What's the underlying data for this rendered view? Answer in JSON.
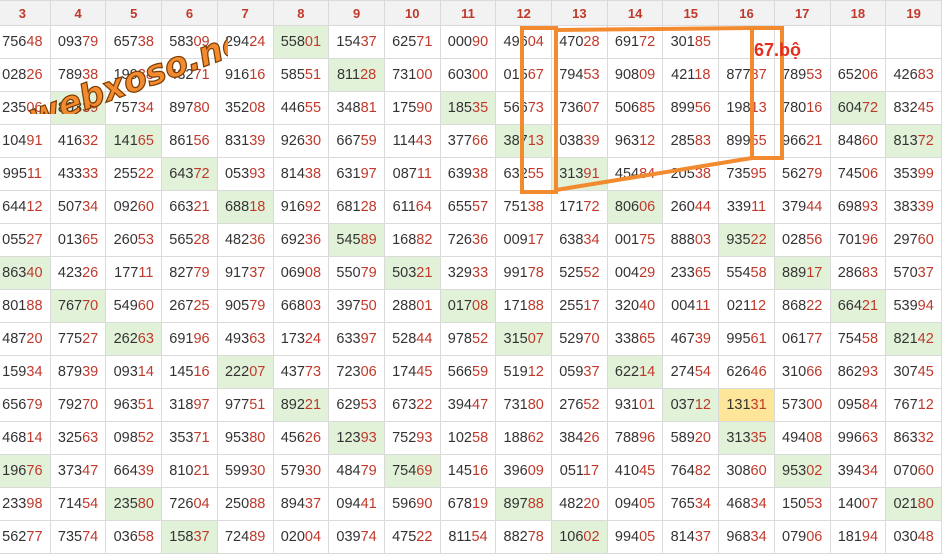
{
  "columns": [
    "3",
    "4",
    "5",
    "6",
    "7",
    "8",
    "9",
    "10",
    "11",
    "12",
    "13",
    "14",
    "15",
    "16",
    "17",
    "18",
    "19"
  ],
  "rows": [
    [
      "75648",
      "09379",
      "65738",
      "58309",
      "29424",
      "55801",
      "15437",
      "62571",
      "00090",
      "49604",
      "47028",
      "69172",
      "30185",
      "",
      "",
      "",
      ""
    ],
    [
      "02826",
      "78938",
      "19938",
      "43271",
      "91616",
      "58551",
      "81128",
      "73100",
      "60300",
      "01567",
      "79453",
      "90809",
      "42118",
      "87787",
      "78953",
      "65206",
      "42683"
    ],
    [
      "23506",
      "80339",
      "75734",
      "89780",
      "35208",
      "44655",
      "34881",
      "17590",
      "18535",
      "56673",
      "73607",
      "50685",
      "89956",
      "19813",
      "78016",
      "60472",
      "83245"
    ],
    [
      "10491",
      "41632",
      "14165",
      "86156",
      "83139",
      "92630",
      "66759",
      "11443",
      "37766",
      "38713",
      "03839",
      "96312",
      "28583",
      "89955",
      "96621",
      "84860",
      "81372"
    ],
    [
      "99511",
      "43333",
      "25522",
      "64372",
      "05393",
      "81438",
      "63197",
      "08711",
      "63938",
      "63255",
      "31391",
      "45484",
      "20538",
      "73595",
      "56279",
      "74506",
      "35399"
    ],
    [
      "64412",
      "50734",
      "09260",
      "66321",
      "68818",
      "91692",
      "68128",
      "61164",
      "65557",
      "75138",
      "17172",
      "80606",
      "26044",
      "33911",
      "37944",
      "69893",
      "38339"
    ],
    [
      "05527",
      "01365",
      "26053",
      "56528",
      "48236",
      "69236",
      "54589",
      "16882",
      "72636",
      "00917",
      "63834",
      "00175",
      "88803",
      "93522",
      "02856",
      "70196",
      "29760"
    ],
    [
      "86340",
      "42326",
      "17711",
      "82779",
      "91737",
      "06908",
      "55079",
      "50321",
      "32933",
      "99178",
      "52552",
      "00429",
      "23365",
      "55458",
      "88917",
      "28683",
      "57037"
    ],
    [
      "80188",
      "76770",
      "54960",
      "26725",
      "90579",
      "66803",
      "39750",
      "28801",
      "01708",
      "17188",
      "25517",
      "32040",
      "00411",
      "02112",
      "86822",
      "66421",
      "53994"
    ],
    [
      "48720",
      "77527",
      "26263",
      "69196",
      "49363",
      "17324",
      "63397",
      "52844",
      "97852",
      "31507",
      "52970",
      "33865",
      "46739",
      "99561",
      "06177",
      "75458",
      "82142"
    ],
    [
      "15934",
      "87939",
      "09314",
      "14516",
      "22207",
      "43773",
      "72306",
      "17445",
      "56659",
      "51912",
      "05937",
      "62214",
      "27454",
      "62646",
      "31066",
      "86293",
      "30745"
    ],
    [
      "65679",
      "79270",
      "96351",
      "31897",
      "97751",
      "89221",
      "62953",
      "67322",
      "39447",
      "73180",
      "27652",
      "93101",
      "03712",
      "13131",
      "57300",
      "09584",
      "76712"
    ],
    [
      "46814",
      "32563",
      "09852",
      "35371",
      "95380",
      "45626",
      "12393",
      "75293",
      "10258",
      "18862",
      "38426",
      "78896",
      "58920",
      "31335",
      "49408",
      "99663",
      "86332"
    ],
    [
      "19676",
      "37347",
      "66439",
      "81021",
      "59930",
      "57930",
      "48479",
      "75469",
      "14516",
      "39609",
      "05117",
      "41045",
      "76482",
      "30860",
      "95302",
      "39434",
      "07060"
    ],
    [
      "23398",
      "71454",
      "23580",
      "72604",
      "25088",
      "89437",
      "09441",
      "59690",
      "67819",
      "89788",
      "48220",
      "09405",
      "76534",
      "46834",
      "15053",
      "14007",
      "02180"
    ],
    [
      "56277",
      "73574",
      "03658",
      "15837",
      "72489",
      "02004",
      "03974",
      "47522",
      "81154",
      "88278",
      "10602",
      "99405",
      "81437",
      "96834",
      "07906",
      "18194",
      "03048"
    ]
  ],
  "highlights": [
    [
      0,
      5
    ],
    [
      1,
      6
    ],
    [
      2,
      1
    ],
    [
      2,
      8
    ],
    [
      2,
      15
    ],
    [
      3,
      2
    ],
    [
      3,
      9
    ],
    [
      3,
      16
    ],
    [
      4,
      3
    ],
    [
      4,
      10
    ],
    [
      5,
      4
    ],
    [
      5,
      11
    ],
    [
      6,
      6
    ],
    [
      6,
      13
    ],
    [
      7,
      0
    ],
    [
      7,
      7
    ],
    [
      7,
      14
    ],
    [
      8,
      1
    ],
    [
      8,
      8
    ],
    [
      8,
      15
    ],
    [
      9,
      2
    ],
    [
      9,
      9
    ],
    [
      9,
      16
    ],
    [
      10,
      4
    ],
    [
      10,
      11
    ],
    [
      11,
      5
    ],
    [
      11,
      12
    ],
    [
      12,
      6
    ],
    [
      12,
      13
    ],
    [
      13,
      0
    ],
    [
      13,
      7
    ],
    [
      13,
      14
    ],
    [
      14,
      2
    ],
    [
      14,
      9
    ],
    [
      14,
      16
    ],
    [
      15,
      3
    ],
    [
      15,
      10
    ]
  ],
  "yellow": [
    [
      11,
      13
    ]
  ],
  "logo_text": "webxoso.net",
  "annotation_label": "67.bộ",
  "colors": {
    "accent": "#c0392b",
    "highlight": "#e2f2d9",
    "yellow": "#fde59a",
    "annotation": "#f28a2f"
  }
}
